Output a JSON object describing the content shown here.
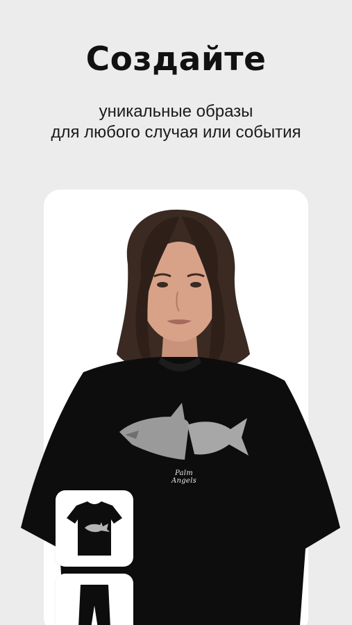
{
  "headline": "Создайте",
  "subheadline": {
    "line1": "уникальные образы",
    "line2": "для любого случая или события"
  },
  "shirt_print_text": "Palm Angels",
  "outfit_items": [
    {
      "name": "tshirt",
      "icon": "tshirt-icon"
    },
    {
      "name": "pants",
      "icon": "pants-icon"
    }
  ],
  "colors": {
    "background": "#ececec",
    "card": "#ffffff",
    "text": "#111111",
    "garment": "#0d0d0d"
  }
}
